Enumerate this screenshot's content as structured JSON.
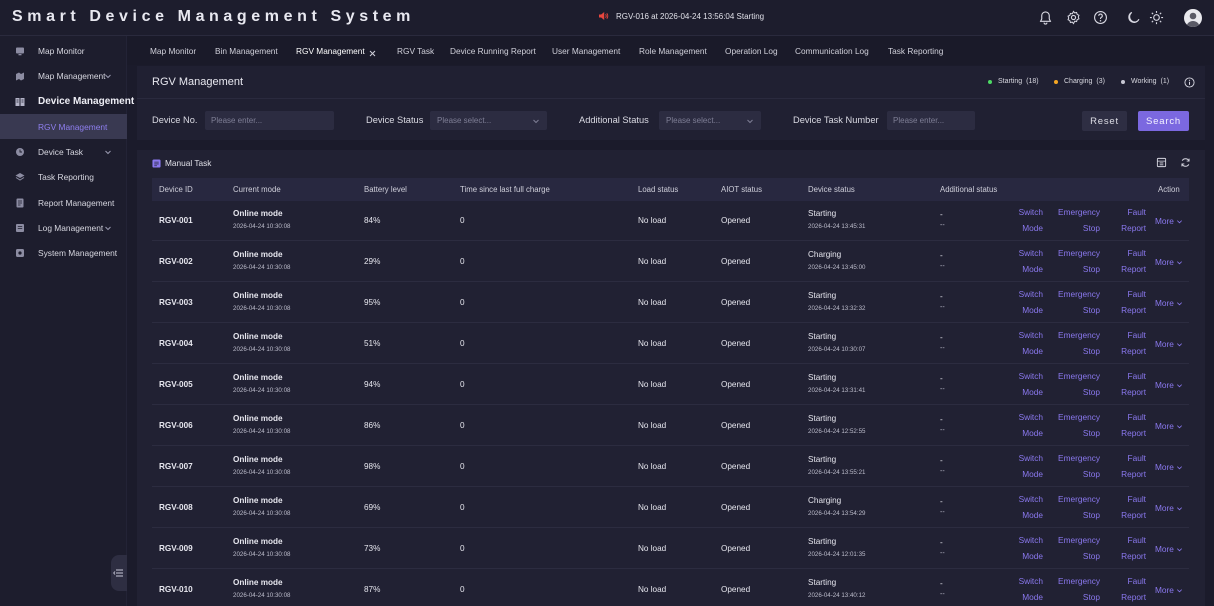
{
  "app_title": "Smart Device Management System",
  "alarm_text": "RGV-016 at 2026-04-24 13:56:04 Starting",
  "top_icons": [
    "bell-icon",
    "gear-icon",
    "help-icon",
    "moon-icon",
    "sun-icon"
  ],
  "sidebar": {
    "items": [
      {
        "label": "Map Monitor",
        "icon": "monitor-icon",
        "expandable": false
      },
      {
        "label": "Map Management",
        "icon": "map-icon",
        "expandable": true
      },
      {
        "label": "Device Management",
        "icon": "device-icon",
        "section": true
      },
      {
        "label": "RGV Management",
        "child": true,
        "active": true
      },
      {
        "label": "Device Task",
        "icon": "task-icon",
        "expandable": true
      },
      {
        "label": "Task Reporting",
        "icon": "layers-icon",
        "expandable": false
      },
      {
        "label": "Report Management",
        "icon": "report-icon",
        "expandable": false
      },
      {
        "label": "Log Management",
        "icon": "log-icon",
        "expandable": true
      },
      {
        "label": "System Management",
        "icon": "system-icon",
        "expandable": false
      }
    ]
  },
  "tabs": [
    "Map Monitor",
    "Bin Management",
    "RGV Management",
    "RGV Task",
    "Device Running Report",
    "User Management",
    "Role Management",
    "Operation Log",
    "Communication Log",
    "Task Reporting"
  ],
  "active_tab": "RGV Management",
  "page_title": "RGV Management",
  "legend": [
    {
      "label": "Starting",
      "count": "(18)",
      "color": "#4cd964"
    },
    {
      "label": "Charging",
      "count": "(3)",
      "color": "#f5a623"
    },
    {
      "label": "Working",
      "count": "(1)",
      "color": "#c8c8d4"
    }
  ],
  "filters": {
    "device_no_label": "Device No.",
    "device_no_placeholder": "Please enter...",
    "device_status_label": "Device Status",
    "device_status_placeholder": "Please select...",
    "additional_status_label": "Additional Status",
    "additional_status_placeholder": "Please select...",
    "task_number_label": "Device Task Number",
    "task_number_placeholder": "Please enter...",
    "reset_label": "Reset",
    "search_label": "Search"
  },
  "table": {
    "section_title": "Manual Task",
    "columns": [
      "Device ID",
      "Current mode",
      "Battery level",
      "Time since last full charge",
      "Load status",
      "AIOT status",
      "Device status",
      "Additional status",
      "Action"
    ],
    "actions": {
      "switch_1": "Switch",
      "switch_2": "Mode",
      "emergency_1": "Emergency",
      "emergency_2": "Stop",
      "fault_1": "Fault",
      "fault_2": "Report",
      "more": "More"
    },
    "rows": [
      {
        "id": "RGV-001",
        "mode": "Online mode",
        "mode_time": "2026-04-24 10:30:08",
        "battery": "84%",
        "since": "0",
        "load": "No load",
        "aiot": "Opened",
        "status": "Starting",
        "status_time": "2026-04-24 13:45:31",
        "add1": "-",
        "add2": "--"
      },
      {
        "id": "RGV-002",
        "mode": "Online mode",
        "mode_time": "2026-04-24 10:30:08",
        "battery": "29%",
        "since": "0",
        "load": "No load",
        "aiot": "Opened",
        "status": "Charging",
        "status_time": "2026-04-24 13:45:00",
        "add1": "-",
        "add2": "--"
      },
      {
        "id": "RGV-003",
        "mode": "Online mode",
        "mode_time": "2026-04-24 10:30:08",
        "battery": "95%",
        "since": "0",
        "load": "No load",
        "aiot": "Opened",
        "status": "Starting",
        "status_time": "2026-04-24 13:32:32",
        "add1": "-",
        "add2": "--"
      },
      {
        "id": "RGV-004",
        "mode": "Online mode",
        "mode_time": "2026-04-24 10:30:08",
        "battery": "51%",
        "since": "0",
        "load": "No load",
        "aiot": "Opened",
        "status": "Starting",
        "status_time": "2026-04-24 10:30:07",
        "add1": "-",
        "add2": "--"
      },
      {
        "id": "RGV-005",
        "mode": "Online mode",
        "mode_time": "2026-04-24 10:30:08",
        "battery": "94%",
        "since": "0",
        "load": "No load",
        "aiot": "Opened",
        "status": "Starting",
        "status_time": "2026-04-24 13:31:41",
        "add1": "-",
        "add2": "--"
      },
      {
        "id": "RGV-006",
        "mode": "Online mode",
        "mode_time": "2026-04-24 10:30:08",
        "battery": "86%",
        "since": "0",
        "load": "No load",
        "aiot": "Opened",
        "status": "Starting",
        "status_time": "2026-04-24 12:52:55",
        "add1": "-",
        "add2": "--"
      },
      {
        "id": "RGV-007",
        "mode": "Online mode",
        "mode_time": "2026-04-24 10:30:08",
        "battery": "98%",
        "since": "0",
        "load": "No load",
        "aiot": "Opened",
        "status": "Starting",
        "status_time": "2026-04-24 13:55:21",
        "add1": "-",
        "add2": "--"
      },
      {
        "id": "RGV-008",
        "mode": "Online mode",
        "mode_time": "2026-04-24 10:30:08",
        "battery": "69%",
        "since": "0",
        "load": "No load",
        "aiot": "Opened",
        "status": "Charging",
        "status_time": "2026-04-24 13:54:29",
        "add1": "-",
        "add2": "--"
      },
      {
        "id": "RGV-009",
        "mode": "Online mode",
        "mode_time": "2026-04-24 10:30:08",
        "battery": "73%",
        "since": "0",
        "load": "No load",
        "aiot": "Opened",
        "status": "Starting",
        "status_time": "2026-04-24 12:01:35",
        "add1": "-",
        "add2": "--"
      },
      {
        "id": "RGV-010",
        "mode": "Online mode",
        "mode_time": "2026-04-24 10:30:08",
        "battery": "87%",
        "since": "0",
        "load": "No load",
        "aiot": "Opened",
        "status": "Starting",
        "status_time": "2026-04-24 13:40:12",
        "add1": "-",
        "add2": "--"
      }
    ]
  }
}
